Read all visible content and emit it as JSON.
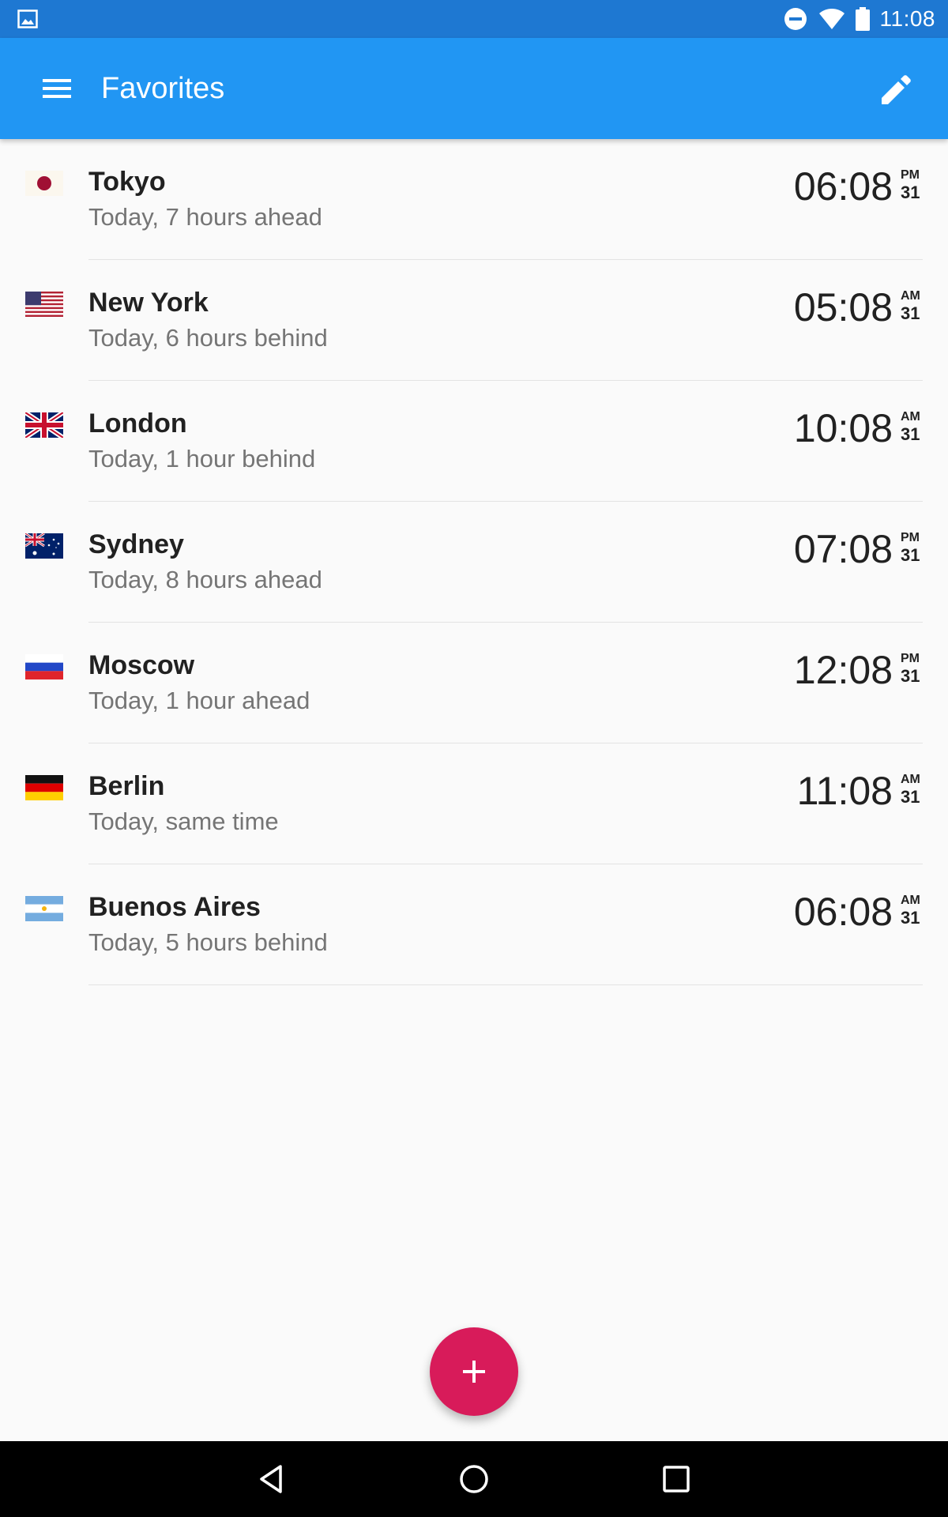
{
  "status_bar": {
    "time": "11:08",
    "left_icon": "image-notification-icon",
    "icons": [
      "do-not-disturb-icon",
      "wifi-icon",
      "battery-icon"
    ]
  },
  "app_bar": {
    "title": "Favorites",
    "menu_icon": "menu-icon",
    "edit_icon": "edit-icon",
    "color": "#2196f3"
  },
  "cities": [
    {
      "name": "Tokyo",
      "difference": "Today, 7 hours ahead",
      "time": "06:08",
      "ampm": "PM",
      "day": "31",
      "flag": "japan-flag-icon"
    },
    {
      "name": "New York",
      "difference": "Today, 6 hours behind",
      "time": "05:08",
      "ampm": "AM",
      "day": "31",
      "flag": "usa-flag-icon"
    },
    {
      "name": "London",
      "difference": "Today, 1 hour behind",
      "time": "10:08",
      "ampm": "AM",
      "day": "31",
      "flag": "uk-flag-icon"
    },
    {
      "name": "Sydney",
      "difference": "Today, 8 hours ahead",
      "time": "07:08",
      "ampm": "PM",
      "day": "31",
      "flag": "australia-flag-icon"
    },
    {
      "name": "Moscow",
      "difference": "Today, 1 hour ahead",
      "time": "12:08",
      "ampm": "PM",
      "day": "31",
      "flag": "russia-flag-icon"
    },
    {
      "name": "Berlin",
      "difference": "Today, same time",
      "time": "11:08",
      "ampm": "AM",
      "day": "31",
      "flag": "germany-flag-icon"
    },
    {
      "name": "Buenos Aires",
      "difference": "Today, 5 hours behind",
      "time": "06:08",
      "ampm": "AM",
      "day": "31",
      "flag": "argentina-flag-icon"
    }
  ],
  "fab": {
    "icon": "plus-icon",
    "color": "#d81b5a"
  },
  "nav_bar": {
    "buttons": [
      "back-icon",
      "home-icon",
      "recents-icon"
    ]
  }
}
